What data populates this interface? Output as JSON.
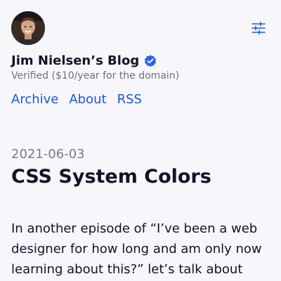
{
  "header": {
    "avatar_alt": "Jim Nielsen",
    "settings_icon": "sliders-icon"
  },
  "site": {
    "title": "Jim Nielsen’s Blog",
    "badge_icon": "verified-check-icon",
    "subtitle": "Verified ($10/year for the domain)"
  },
  "nav": {
    "items": [
      {
        "label": "Archive"
      },
      {
        "label": "About"
      },
      {
        "label": "RSS"
      }
    ]
  },
  "post": {
    "date": "2021-06-03",
    "title": "CSS System Colors",
    "body": "In another episode of “I’ve been a web designer for how long and am only now learning about this?” let’s talk about"
  },
  "colors": {
    "background": "#f7f7fb",
    "text": "#101427",
    "link": "#1a56db",
    "muted": "#707080",
    "badge": "#2563eb"
  }
}
